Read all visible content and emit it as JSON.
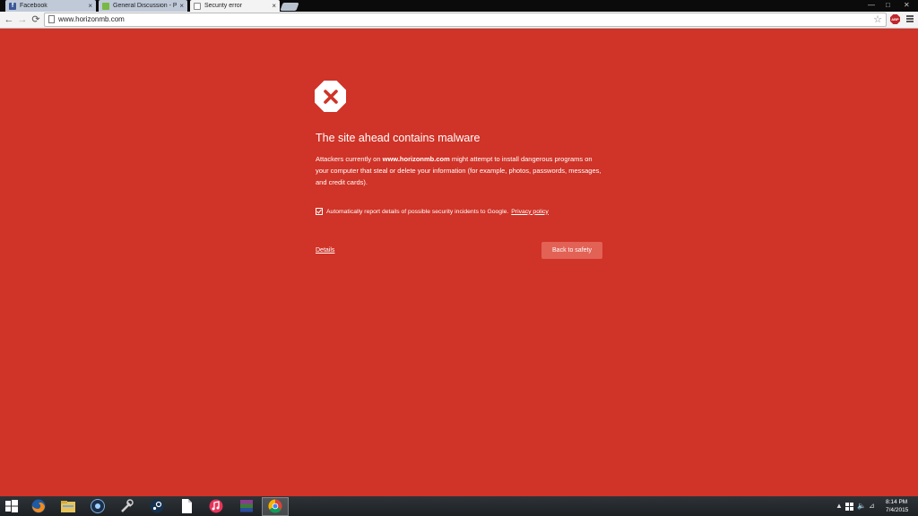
{
  "browser": {
    "tabs": [
      {
        "title": "Facebook",
        "favicon": "facebook-icon",
        "active": false
      },
      {
        "title": "General Discussion - Port",
        "favicon": "forum-icon",
        "active": false
      },
      {
        "title": "Security error",
        "favicon": "page-icon",
        "active": true
      }
    ],
    "tab_close_glyph": "×",
    "address": "www.horizonmb.com",
    "extension_badge": "ABP",
    "icons": [
      "back-arrow-icon",
      "forward-arrow-icon",
      "reload-icon",
      "star-icon",
      "menu-icon"
    ]
  },
  "interstitial": {
    "background_color": "#d03327",
    "icon": "warning-octagon-x-icon",
    "heading": "The site ahead contains malware",
    "explanation_prefix": "Attackers currently on ",
    "explanation_site": "www.horizonmb.com",
    "explanation_suffix": " might attempt to install dangerous programs on your computer that steal or delete your information (for example, photos, passwords, messages, and credit cards).",
    "report_checked": true,
    "report_label": "Automatically report details of possible security incidents to Google.",
    "privacy_link": "Privacy policy",
    "details_link": "Details",
    "back_button": "Back to safety"
  },
  "taskbar": {
    "pinned": [
      "start-button",
      "firefox-icon",
      "file-explorer-icon",
      "steam-like-orb-icon",
      "tools-icon",
      "steam-icon",
      "document-icon",
      "itunes-icon",
      "winrar-icon",
      "chrome-icon"
    ],
    "clock_time": "8:14 PM",
    "clock_date": "7/4/2015"
  }
}
